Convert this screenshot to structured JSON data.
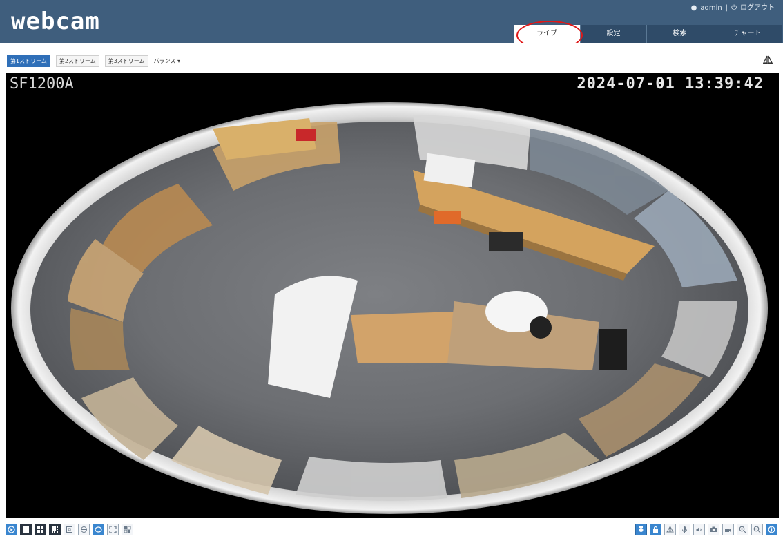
{
  "header": {
    "logo": "webcam",
    "user": "admin",
    "logout_label": "ログアウト",
    "user_icon": "user-icon",
    "power_icon": "power-icon"
  },
  "tabs": [
    {
      "label": "ライブ",
      "active": true
    },
    {
      "label": "設定",
      "active": false
    },
    {
      "label": "検索",
      "active": false
    },
    {
      "label": "チャート",
      "active": false
    }
  ],
  "streams": {
    "items": [
      {
        "label": "第1ストリーム",
        "active": true
      },
      {
        "label": "第2ストリーム",
        "active": false
      },
      {
        "label": "第3ストリーム",
        "active": false
      }
    ],
    "balance_label": "バランス ▾"
  },
  "video": {
    "camera_name": "SF1200A",
    "timestamp": "2024-07-01  13:39:42"
  },
  "toolbar": {
    "left_icons": [
      "play-icon",
      "single-view-icon",
      "quad-view-icon",
      "multi-view-icon",
      "square-view-icon",
      "panorama-icon",
      "fisheye-icon",
      "fullscreen-icon",
      "split-view-icon"
    ],
    "right_icons": [
      "ptz-icon",
      "lock-icon",
      "mirror-icon",
      "microphone-icon",
      "speaker-icon",
      "snapshot-icon",
      "record-icon",
      "zoom-in-icon",
      "zoom-out-icon",
      "info-icon"
    ]
  },
  "colors": {
    "header_bg": "#3f5e7d",
    "tab_bg": "#2f4b68",
    "accent_blue": "#3a86cf",
    "highlight_red": "#e01818"
  }
}
